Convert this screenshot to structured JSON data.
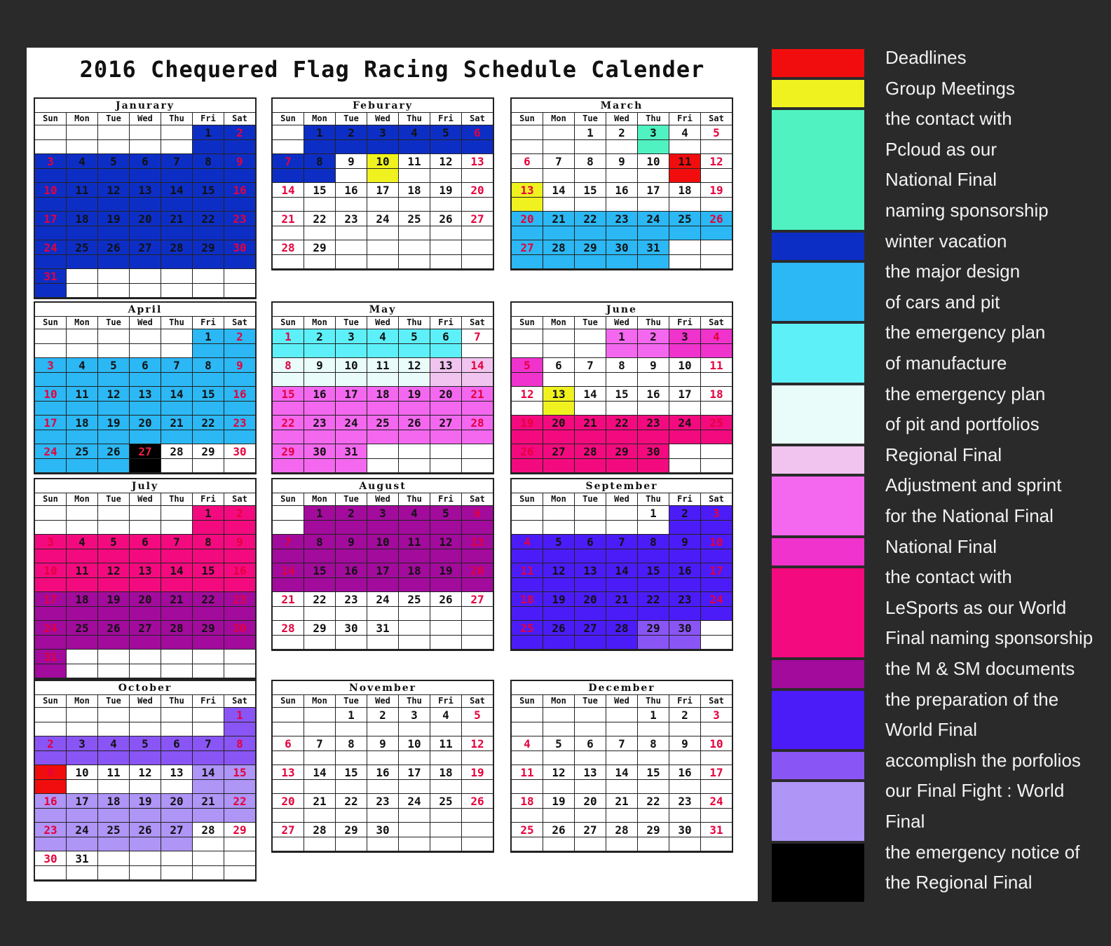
{
  "title": "2016 Chequered Flag Racing Schedule Calender",
  "weekdays": [
    "Sun",
    "Mon",
    "Tue",
    "Wed",
    "Thu",
    "Fri",
    "Sat"
  ],
  "colors": {
    "red": "#f10d0d",
    "yellow": "#f0f220",
    "mint": "#4ff2c0",
    "navy": "#0d2ec5",
    "sky": "#2bb8f4",
    "cyan": "#5df0f8",
    "ice": "#e9fcfa",
    "lilac": "#f1c4f0",
    "pink": "#f468ef",
    "magenta": "#f033cc",
    "rose": "#f40a7f",
    "purple": "#a20b9c",
    "violet": "#4b1cf7",
    "lavender": "#8a55f5",
    "pale_violet": "#ae95f6",
    "black": "#000000"
  },
  "months": [
    {
      "name": "Janurary",
      "start": 5,
      "days": 31,
      "color": {
        "1-31": "navy"
      }
    },
    {
      "name": "Feburary",
      "start": 1,
      "days": 29,
      "color": {
        "1-8": "navy",
        "10": "yellow"
      }
    },
    {
      "name": "March",
      "start": 2,
      "days": 31,
      "color": {
        "3": "mint",
        "11": "red",
        "13": "yellow",
        "20-31": "sky"
      }
    },
    {
      "name": "April",
      "start": 5,
      "days": 30,
      "color": {
        "1-26": "sky",
        "14": "yellow",
        "27": "black"
      }
    },
    {
      "name": "May",
      "start": 0,
      "days": 31,
      "color": {
        "1-6": "cyan",
        "8-12": "ice",
        "13-14": "lilac",
        "15-21": "pink",
        "22-28": "pink",
        "29-31": "pink"
      }
    },
    {
      "name": "June",
      "start": 3,
      "days": 30,
      "color": {
        "1-2": "pink",
        "3-5": "magenta",
        "13": "yellow",
        "19-30": "rose"
      }
    },
    {
      "name": "July",
      "start": 5,
      "days": 31,
      "color": {
        "1-16": "rose",
        "14": "yellow",
        "17-31": "purple"
      }
    },
    {
      "name": "August",
      "start": 1,
      "days": 31,
      "color": {
        "1-20": "purple"
      }
    },
    {
      "name": "September",
      "start": 4,
      "days": 30,
      "color": {
        "2-28": "violet",
        "29-30": "lavender"
      }
    },
    {
      "name": "October",
      "start": 6,
      "days": 31,
      "color": {
        "1-8": "lavender",
        "9": "red",
        "14-15": "pale_violet",
        "16-22": "pale_violet",
        "23-27": "pale_violet"
      }
    },
    {
      "name": "November",
      "start": 2,
      "days": 30,
      "color": {}
    },
    {
      "name": "December",
      "start": 4,
      "days": 31,
      "color": {}
    }
  ],
  "legend": [
    {
      "color": "red",
      "lines": [
        "Deadlines"
      ]
    },
    {
      "color": "yellow",
      "lines": [
        "Group Meetings"
      ]
    },
    {
      "color": "mint",
      "lines": [
        "the contact with",
        "Pcloud as our",
        "National Final",
        "naming sponsorship"
      ]
    },
    {
      "color": "navy",
      "lines": [
        "winter vacation"
      ]
    },
    {
      "color": "sky",
      "lines": [
        "the major design",
        "of cars and pit"
      ]
    },
    {
      "color": "cyan",
      "lines": [
        "the emergency plan",
        "of manufacture"
      ]
    },
    {
      "color": "ice",
      "lines": [
        "the emergency plan",
        "of pit and portfolios"
      ]
    },
    {
      "color": "lilac",
      "lines": [
        "Regional Final"
      ]
    },
    {
      "color": "pink",
      "lines": [
        "Adjustment and sprint",
        "for the National Final"
      ]
    },
    {
      "color": "magenta",
      "lines": [
        "National Final"
      ]
    },
    {
      "color": "rose",
      "lines": [
        "the contact with",
        "LeSports as our World",
        "Final naming sponsorship"
      ]
    },
    {
      "color": "purple",
      "lines": [
        "the M & SM documents"
      ]
    },
    {
      "color": "violet",
      "lines": [
        "the preparation of the",
        "World Final"
      ]
    },
    {
      "color": "lavender",
      "lines": [
        "accomplish the porfolios"
      ]
    },
    {
      "color": "pale_violet",
      "lines": [
        "our Final Fight : World",
        "Final"
      ]
    },
    {
      "color": "black",
      "lines": [
        "the emergency notice of",
        "the Regional Final"
      ]
    }
  ]
}
